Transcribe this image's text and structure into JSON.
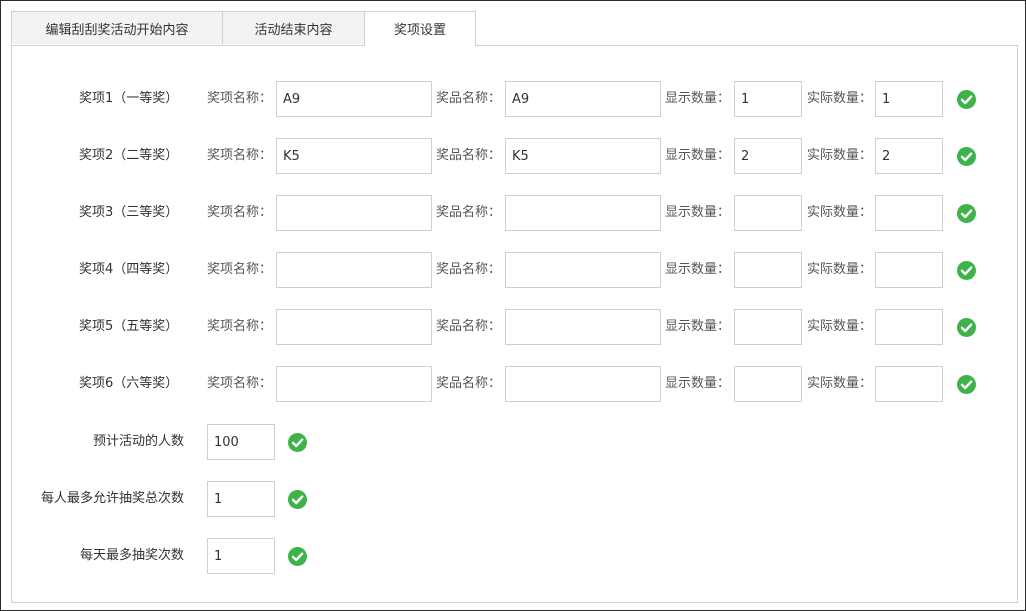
{
  "tabs": [
    {
      "label": "编辑刮刮奖活动开始内容"
    },
    {
      "label": "活动结束内容"
    },
    {
      "label": "奖项设置"
    }
  ],
  "field_labels": {
    "award_name": "奖项名称：",
    "prize_name": "奖品名称：",
    "display_count": "显示数量：",
    "actual_count": "实际数量："
  },
  "prizes": [
    {
      "label": "奖项1（一等奖）",
      "award_name": "A9",
      "prize_name": "A9",
      "display_count": "1",
      "actual_count": "1"
    },
    {
      "label": "奖项2（二等奖）",
      "award_name": "K5",
      "prize_name": "K5",
      "display_count": "2",
      "actual_count": "2"
    },
    {
      "label": "奖项3（三等奖）",
      "award_name": "",
      "prize_name": "",
      "display_count": "",
      "actual_count": ""
    },
    {
      "label": "奖项4（四等奖）",
      "award_name": "",
      "prize_name": "",
      "display_count": "",
      "actual_count": ""
    },
    {
      "label": "奖项5（五等奖）",
      "award_name": "",
      "prize_name": "",
      "display_count": "",
      "actual_count": ""
    },
    {
      "label": "奖项6（六等奖）",
      "award_name": "",
      "prize_name": "",
      "display_count": "",
      "actual_count": ""
    }
  ],
  "settings": [
    {
      "label": "预计活动的人数",
      "value": "100"
    },
    {
      "label": "每人最多允许抽奖总次数",
      "value": "1"
    },
    {
      "label": "每天最多抽奖次数",
      "value": "1"
    }
  ],
  "colors": {
    "check_green": "#3fb24a",
    "border": "#d0d0d0",
    "tab_inactive_bg": "#f3f3f3"
  },
  "icons": {
    "valid": "check-circle-icon"
  }
}
